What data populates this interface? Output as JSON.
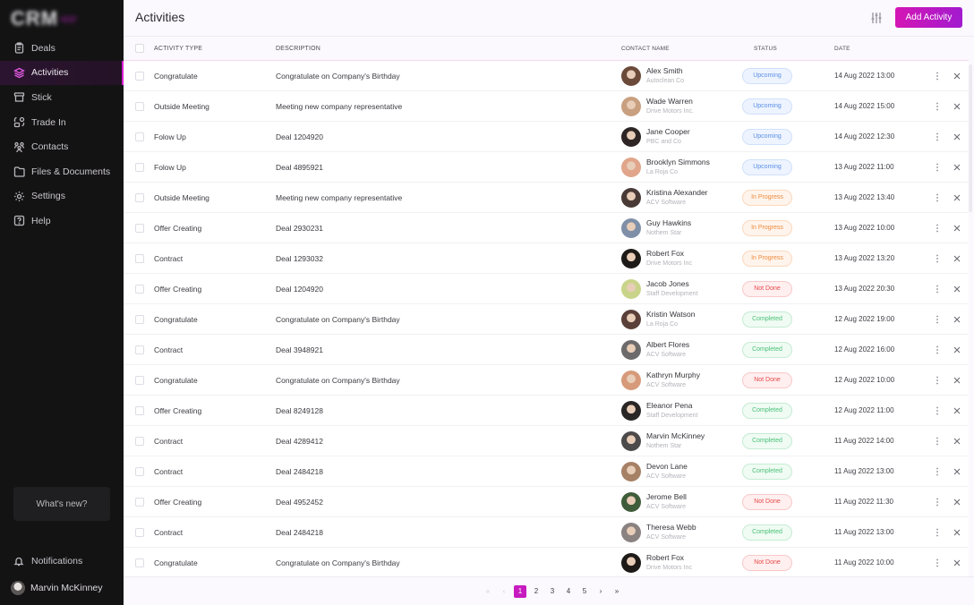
{
  "app": {
    "logo_text": "CRM",
    "logo_sub": "app"
  },
  "sidebar": {
    "items": [
      {
        "label": "Deals",
        "icon": "clipboard-icon",
        "active": false
      },
      {
        "label": "Activities",
        "icon": "layers-icon",
        "active": true
      },
      {
        "label": "Stick",
        "icon": "archive-icon",
        "active": false
      },
      {
        "label": "Trade In",
        "icon": "trade-icon",
        "active": false
      },
      {
        "label": "Contacts",
        "icon": "contacts-icon",
        "active": false
      },
      {
        "label": "Files & Documents",
        "icon": "folder-icon",
        "active": false
      },
      {
        "label": "Settings",
        "icon": "gear-icon",
        "active": false
      },
      {
        "label": "Help",
        "icon": "help-icon",
        "active": false
      }
    ],
    "whats_new": "What's new?",
    "notifications": "Notifications",
    "user_name": "Marvin McKinney"
  },
  "header": {
    "title": "Activities",
    "add_button": "Add Activity"
  },
  "table": {
    "columns": [
      "ACTIVITY TYPE",
      "DESCRIPTION",
      "CONTACT NAME",
      "STATUS",
      "DATE"
    ],
    "rows": [
      {
        "type": "Congratulate",
        "desc": "Congratulate on Company's Birthday",
        "name": "Alex Smith",
        "company": "Autoclean Co",
        "status": "Upcoming",
        "date": "14 Aug 2022 13:00"
      },
      {
        "type": "Outside Meeting",
        "desc": "Meeting new company representative",
        "name": "Wade Warren",
        "company": "Drive Motors Inc.",
        "status": "Upcoming",
        "date": "14 Aug 2022 15:00"
      },
      {
        "type": "Folow Up",
        "desc": "Deal 1204920",
        "name": "Jane Cooper",
        "company": "PBC and Co",
        "status": "Upcoming",
        "date": "14 Aug 2022 12:30"
      },
      {
        "type": "Folow Up",
        "desc": "Deal 4895921",
        "name": "Brooklyn Simmons",
        "company": "La Roja Co",
        "status": "Upcoming",
        "date": "13 Aug 2022 11:00"
      },
      {
        "type": "Outside Meeting",
        "desc": "Meeting new company representative",
        "name": "Kristina Alexander",
        "company": "ACV Software",
        "status": "In Progress",
        "date": "13 Aug 2022 13:40"
      },
      {
        "type": "Offer Creating",
        "desc": "Deal 2930231",
        "name": "Guy Hawkins",
        "company": "Nothem Star",
        "status": "In Progress",
        "date": "13 Aug 2022 10:00"
      },
      {
        "type": "Contract",
        "desc": "Deal 1293032",
        "name": "Robert Fox",
        "company": "Drive Motors Inc",
        "status": "In Progress",
        "date": "13 Aug 2022 13:20"
      },
      {
        "type": "Offer Creating",
        "desc": "Deal 1204920",
        "name": "Jacob Jones",
        "company": "Staff Development",
        "status": "Not Done",
        "date": "13 Aug 2022 20:30"
      },
      {
        "type": "Congratulate",
        "desc": "Congratulate on Company's Birthday",
        "name": "Kristin Watson",
        "company": "La Roja Co",
        "status": "Completed",
        "date": "12 Aug 2022 19:00"
      },
      {
        "type": "Contract",
        "desc": "Deal 3948921",
        "name": "Albert Flores",
        "company": "ACV Software",
        "status": "Completed",
        "date": "12 Aug 2022 16:00"
      },
      {
        "type": "Congratulate",
        "desc": "Congratulate on Company's Birthday",
        "name": "Kathryn Murphy",
        "company": "ACV Software",
        "status": "Not Done",
        "date": "12 Aug 2022 10:00"
      },
      {
        "type": "Offer Creating",
        "desc": "Deal 8249128",
        "name": "Eleanor Pena",
        "company": "Staff Development",
        "status": "Completed",
        "date": "12 Aug 2022 11:00"
      },
      {
        "type": "Contract",
        "desc": "Deal 4289412",
        "name": "Marvin McKinney",
        "company": "Nothem Star",
        "status": "Completed",
        "date": "11 Aug 2022 14:00"
      },
      {
        "type": "Contract",
        "desc": "Deal 2484218",
        "name": "Devon Lane",
        "company": "ACV Software",
        "status": "Completed",
        "date": "11 Aug 2022 13:00"
      },
      {
        "type": "Offer Creating",
        "desc": "Deal 4952452",
        "name": "Jerome Bell",
        "company": "ACV Software",
        "status": "Not Done",
        "date": "11 Aug 2022 11:30"
      },
      {
        "type": "Contract",
        "desc": "Deal 2484218",
        "name": "Theresa Webb",
        "company": "ACV Software",
        "status": "Completed",
        "date": "11 Aug 2022 13:00"
      },
      {
        "type": "Congratulate",
        "desc": "Congratulate on Company's Birthday",
        "name": "Robert Fox",
        "company": "Drive Motors Inc",
        "status": "Not Done",
        "date": "11 Aug 2022 10:00"
      }
    ]
  },
  "status_colors": {
    "Upcoming": {
      "text": "#5b8fe6",
      "bg": "#eef4ff",
      "border": "#cfe0fb"
    },
    "In Progress": {
      "text": "#ee8a3c",
      "bg": "#fff4ec",
      "border": "#fbd8be"
    },
    "Not Done": {
      "text": "#e84a4a",
      "bg": "#ffefef",
      "border": "#f8c9c9"
    },
    "Completed": {
      "text": "#4cc27a",
      "bg": "#effbf3",
      "border": "#c6ecd4"
    }
  },
  "avatar_colors": [
    "#6b4a3a",
    "#c8a080",
    "#2d2624",
    "#e0a58a",
    "#4a3a36",
    "#7f8fa8",
    "#1e1a18",
    "#c9d48a",
    "#5a4038",
    "#6c6a6a",
    "#d69a7a",
    "#2a2626",
    "#4c4a4a",
    "#a68166",
    "#3f5d3a",
    "#8a8280",
    "#1e1a18"
  ],
  "pagination": {
    "first": "«",
    "prev": "‹",
    "pages": [
      "1",
      "2",
      "3",
      "4",
      "5"
    ],
    "current": "1",
    "next": "›",
    "last": "»"
  },
  "accent": "#c71bc0"
}
